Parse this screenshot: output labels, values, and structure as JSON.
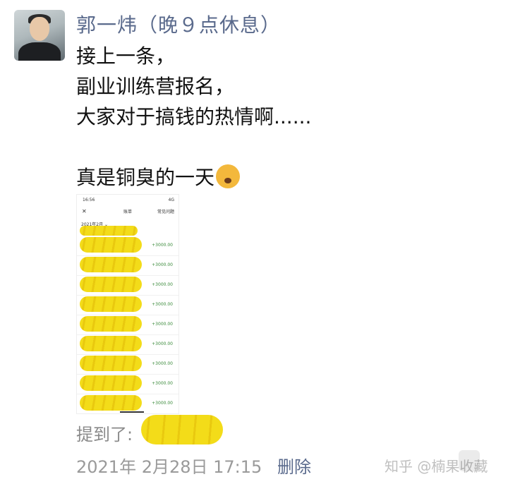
{
  "post": {
    "author": "郭一炜（晚９点休息）",
    "lines": [
      "接上一条，",
      "副业训练营报名，",
      "大家对于搞钱的热情啊......",
      "真是铜臭的一天"
    ],
    "emoji": "money-mouth-icon"
  },
  "screenshot": {
    "status_time": "16:56",
    "status_right": "4G",
    "close": "✕",
    "title": "账单",
    "top_right": "常见问题",
    "month": "2021年2月 ⌄",
    "amounts": [
      "+3000.00",
      "+3000.00",
      "+3000.00",
      "+3000.00",
      "+3000.00",
      "+3000.00",
      "+3000.00",
      "+3000.00",
      "+3000.00"
    ]
  },
  "mention": {
    "label": "提到了:"
  },
  "meta": {
    "timestamp": "2021年 2月28日 17:15",
    "delete_label": "删除"
  },
  "watermark": {
    "text": "知乎 @楠果收藏"
  },
  "colors": {
    "username": "#5a6a8c",
    "highlight": "#f3dc19",
    "amount": "#3a8a3a"
  }
}
